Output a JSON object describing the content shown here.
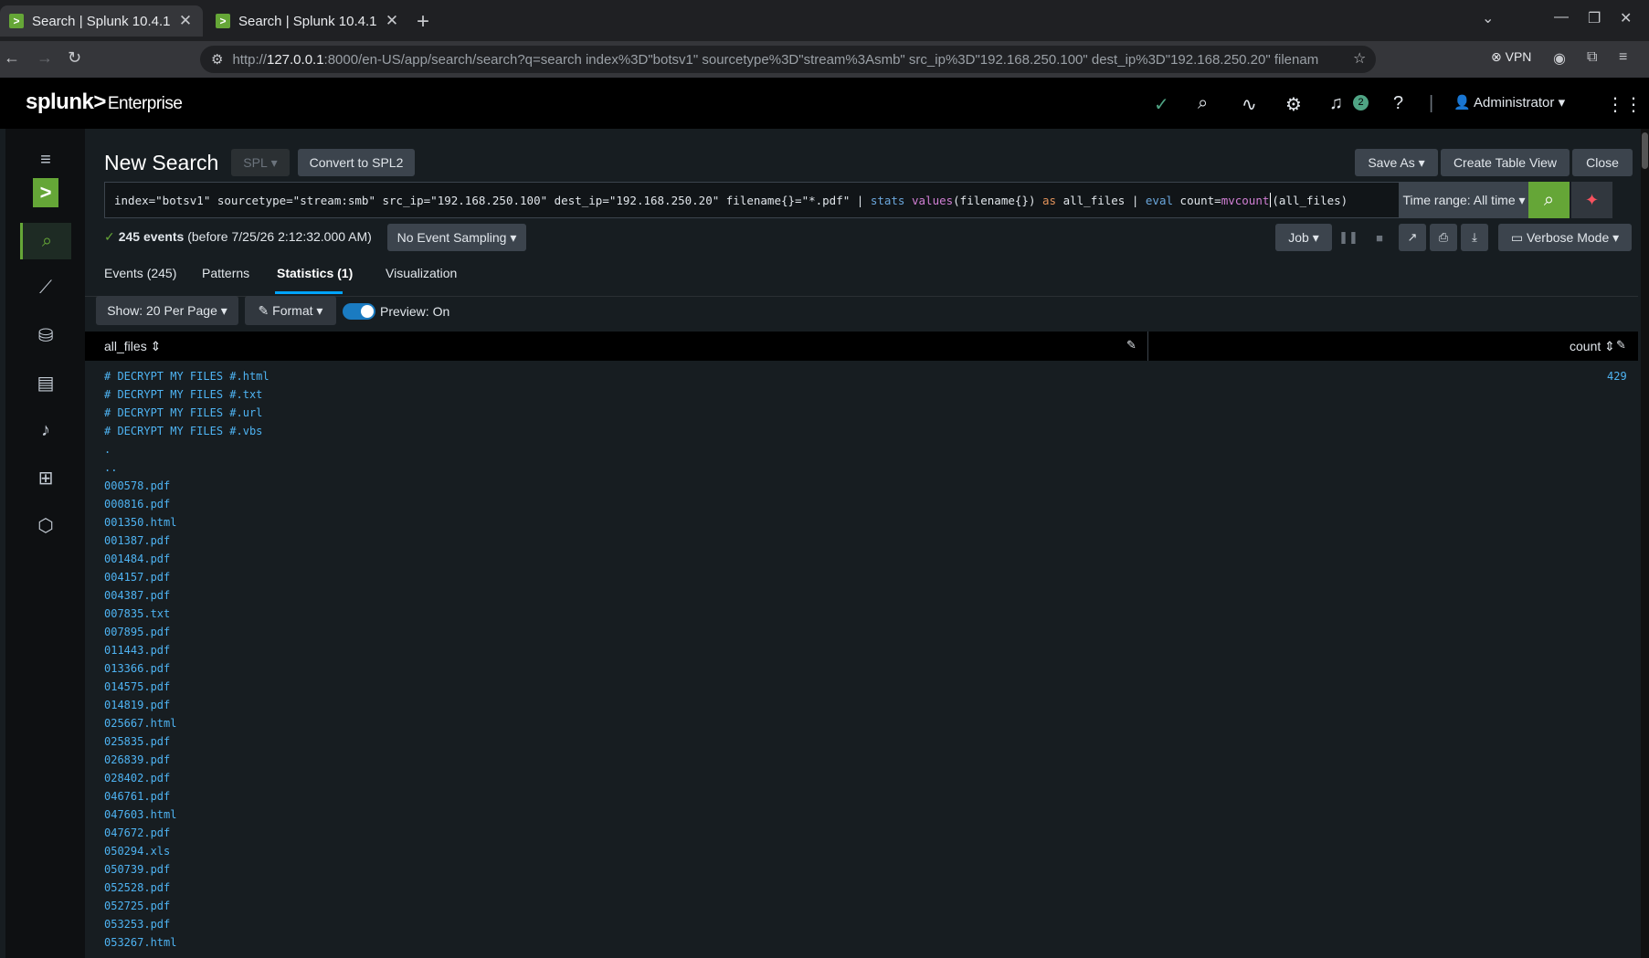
{
  "browser": {
    "tabs": [
      {
        "title": "Search | Splunk 10.4.1",
        "active": true
      },
      {
        "title": "Search | Splunk 10.4.1",
        "active": false
      }
    ],
    "url_prefix": "http://",
    "url_host": "127.0.0.1",
    "url_rest": ":8000/en-US/app/search/search?q=search index%3D\"botsv1\" sourcetype%3D\"stream%3Asmb\" src_ip%3D\"192.168.250.100\" dest_ip%3D\"192.168.250.20\" filenam",
    "vpn_label": "VPN"
  },
  "header": {
    "logo": "splunk>",
    "product": "Enterprise",
    "notifications_count": "2",
    "user": "Administrator"
  },
  "search": {
    "page_title": "New Search",
    "language": "SPL",
    "convert_label": "Convert to SPL2",
    "save_as": "Save As",
    "create_table_view": "Create Table View",
    "close": "Close",
    "query_parts": {
      "p1": "index=\"botsv1\" sourcetype=\"stream:smb\" src_ip=\"192.168.250.100\" dest_ip=\"192.168.250.20\" filename{}=\"*.pdf\" | ",
      "stats": "stats",
      "values": "values",
      "p2": "(filename{}) ",
      "as": "as",
      "p3": " all_files | ",
      "eval": "eval",
      "p4": " count=",
      "mvcount": "mvcount",
      "p5": "(all_files)"
    },
    "time_range": "Time range: All time",
    "events_bold": "245 events",
    "events_rest": " (before 7/25/26 2:12:32.000 AM)",
    "sampling": "No Event Sampling",
    "job": "Job",
    "mode": "Verbose Mode"
  },
  "tabs": {
    "events": "Events (245)",
    "patterns": "Patterns",
    "statistics": "Statistics (1)",
    "visualization": "Visualization"
  },
  "table_toolbar": {
    "per_page": "Show: 20 Per Page",
    "format": "Format",
    "preview": "Preview: On"
  },
  "table": {
    "col_all_files": "all_files",
    "col_count": "count",
    "count_value": "429",
    "all_files": [
      "# DECRYPT MY FILES #.html",
      "# DECRYPT MY FILES #.txt",
      "# DECRYPT MY FILES #.url",
      "# DECRYPT MY FILES #.vbs",
      ".",
      "..",
      "000578.pdf",
      "000816.pdf",
      "001350.html",
      "001387.pdf",
      "001484.pdf",
      "004157.pdf",
      "004387.pdf",
      "007835.txt",
      "007895.pdf",
      "011443.pdf",
      "013366.pdf",
      "014575.pdf",
      "014819.pdf",
      "025667.html",
      "025835.pdf",
      "026839.pdf",
      "028402.pdf",
      "046761.pdf",
      "047603.html",
      "047672.pdf",
      "050294.xls",
      "050739.pdf",
      "052528.pdf",
      "052725.pdf",
      "053253.pdf",
      "053267.html"
    ]
  }
}
